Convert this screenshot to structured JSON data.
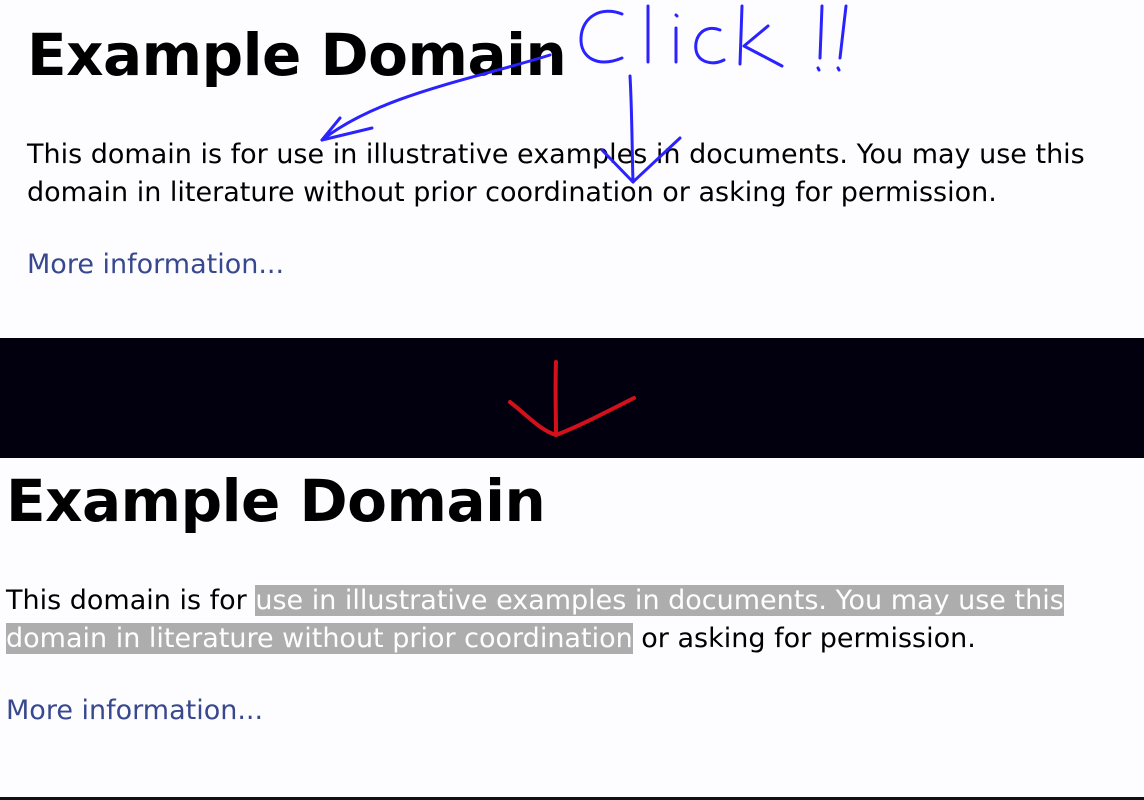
{
  "before_page": {
    "heading": "Example Domain",
    "paragraph_line1": "This domain is for use in illustrative examples in documents. You may use this",
    "paragraph_line2": "domain in literature without prior coordination or asking for permission.",
    "link_text": "More information..."
  },
  "annotations": {
    "click_note": "Click !!",
    "pen_color": "#2a22ff",
    "arrow_color": "#d4101a"
  },
  "after_page": {
    "heading": "Example Domain",
    "line1_unselected": "This domain is for ",
    "line1_selected": "use in illustrative examples in documents. You may use this",
    "line2_selected": "domain in literature without prior coordination",
    "line2_unselected": " or asking for permission.",
    "link_text": "More information...",
    "selection_color": "#adadad"
  }
}
